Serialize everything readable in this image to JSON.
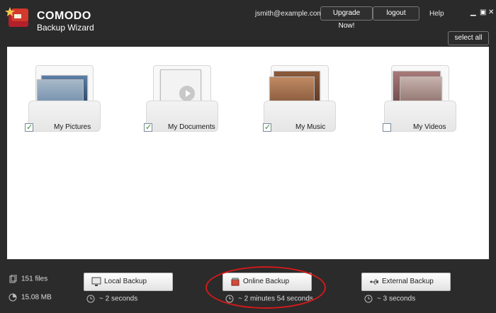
{
  "header": {
    "brand": "COMODO",
    "subtitle": "Backup Wizard",
    "email": "jsmith@example.com",
    "upgrade_label": "Upgrade Now!",
    "logout_label": "logout",
    "help_label": "Help",
    "select_all_label": "select all",
    "window_controls": [
      "minimize-icon",
      "maximize-icon",
      "close-icon"
    ]
  },
  "folders": [
    {
      "label": "My Pictures",
      "checked": true
    },
    {
      "label": "My Documents",
      "checked": true
    },
    {
      "label": "My Music",
      "checked": true
    },
    {
      "label": "My Videos",
      "checked": false
    }
  ],
  "stats": {
    "files": "151 files",
    "size": "15.08 MB"
  },
  "actions": {
    "local": {
      "label": "Local Backup",
      "eta": "~ 2 seconds"
    },
    "online": {
      "label": "Online Backup",
      "eta": "~ 2 minutes 54 seconds"
    },
    "external": {
      "label": "External Backup",
      "eta": "~ 3 seconds"
    }
  },
  "colors": {
    "header_bg": "#2a2a2a",
    "annotation": "#d21a1a",
    "check": "#2a8a2a"
  }
}
